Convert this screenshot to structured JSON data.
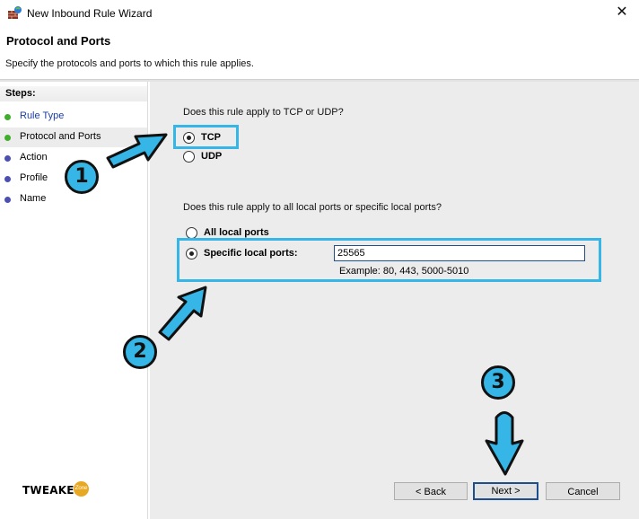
{
  "window": {
    "title": "New Inbound Rule Wizard",
    "close_glyph": "✕"
  },
  "header": {
    "title": "Protocol and Ports",
    "subtitle": "Specify the protocols and ports to which this rule applies."
  },
  "steps": {
    "heading": "Steps:",
    "items": [
      {
        "label": "Rule Type",
        "state": "done"
      },
      {
        "label": "Protocol and Ports",
        "state": "current"
      },
      {
        "label": "Action",
        "state": "pending"
      },
      {
        "label": "Profile",
        "state": "pending"
      },
      {
        "label": "Name",
        "state": "pending"
      }
    ]
  },
  "protocol": {
    "question": "Does this rule apply to TCP or UDP?",
    "options": [
      {
        "label": "TCP",
        "checked": true
      },
      {
        "label": "UDP",
        "checked": false
      }
    ]
  },
  "ports": {
    "question": "Does this rule apply to all local ports or specific local ports?",
    "all_label": "All local ports",
    "specific_label": "Specific local ports:",
    "value": "25565",
    "example": "Example: 80, 443, 5000-5010"
  },
  "buttons": {
    "back": "< Back",
    "next": "Next >",
    "cancel": "Cancel"
  },
  "annotations": {
    "badge1": "1",
    "badge2": "2",
    "badge3": "3",
    "accent": "#35b6e6"
  },
  "watermark": {
    "brand": "TWEAKER",
    "zone": "Zone"
  }
}
